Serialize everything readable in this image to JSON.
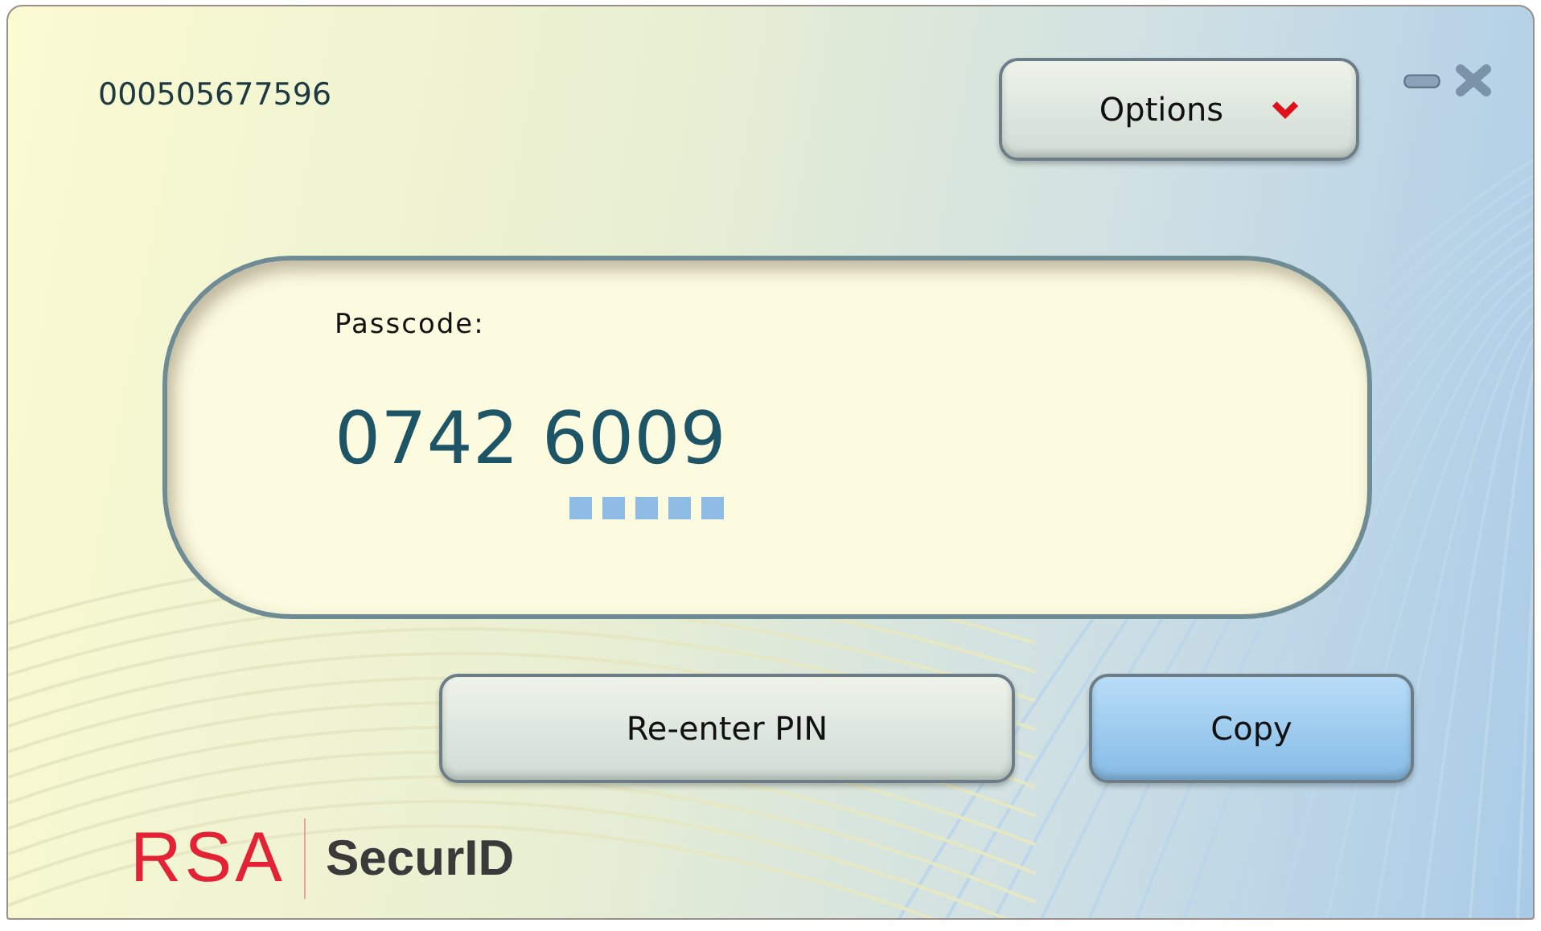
{
  "serial_number": "000505677596",
  "options_button": {
    "label": "Options"
  },
  "passcode": {
    "label": "Passcode:",
    "value": "0742 6009"
  },
  "buttons": [
    {
      "label": "Re-enter PIN",
      "default": false
    },
    {
      "label": "Copy",
      "default": true
    }
  ],
  "logo": {
    "brand": "RSA",
    "product": "SecurID"
  }
}
